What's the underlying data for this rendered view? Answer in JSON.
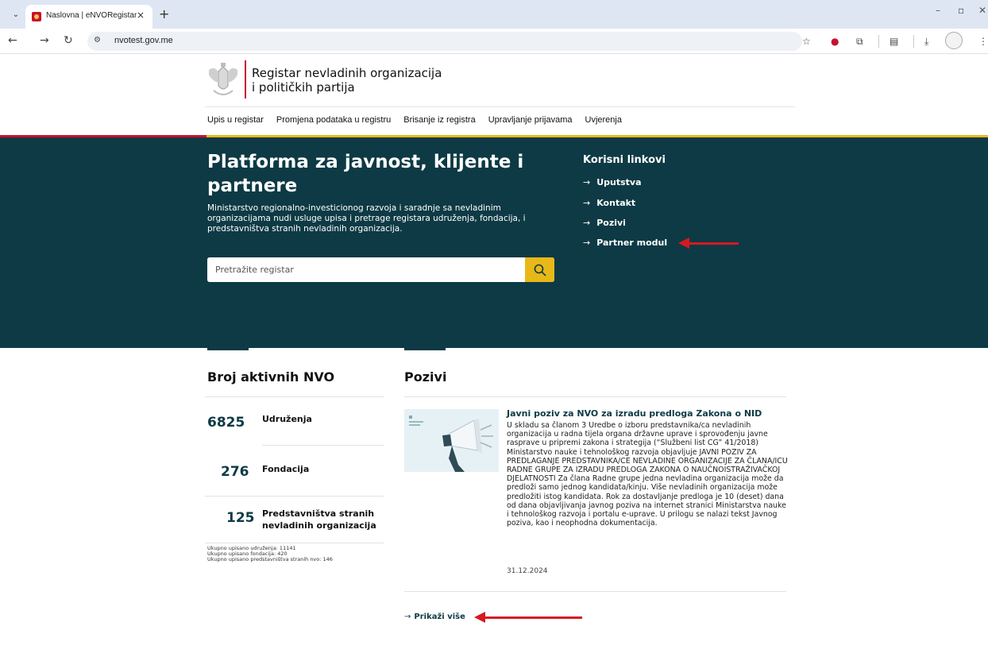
{
  "browser": {
    "tab_title": "Naslovna | eNVORegistar",
    "url": "nvotest.gov.me"
  },
  "site": {
    "logo_line1": "Registar nevladinih organizacija",
    "logo_line2": "i političkih partija",
    "nav": [
      "Upis u registar",
      "Promjena podataka u registru",
      "Brisanje iz registra",
      "Upravljanje prijavama",
      "Uvjerenja"
    ]
  },
  "hero": {
    "title": "Platforma za javnost, klijente i partnere",
    "intro": "Ministarstvo regionalno-investicionog razvoja i saradnje sa nevladinim organizacijama nudi usluge upisa i pretrage registara udruženja, fondacija, i predstavništva stranih nevladinih organizacija.",
    "search_placeholder": "Pretražite registar",
    "links_title": "Korisni linkovi",
    "links": [
      "Uputstva",
      "Kontakt",
      "Pozivi",
      "Partner modul"
    ]
  },
  "stats": {
    "title": "Broj aktivnih NVO",
    "items": [
      {
        "num": "6825",
        "label": "Udruženja"
      },
      {
        "num": "276",
        "label": "Fondacija"
      },
      {
        "num": "125",
        "label": "Predstavništva stranih nevladinih organizacija"
      }
    ],
    "totals": [
      "Ukupno upisano udruženja: 11141",
      "Ukupno upisano fondacija: 420",
      "Ukupno upisano predstavništva stranih nvo: 146"
    ]
  },
  "calls": {
    "title": "Pozivi",
    "item_title": "Javni poziv za NVO za izradu predloga Zakona o NID",
    "item_body": "U skladu sa članom 3 Uredbe o izboru predstavnika/ca nevladinih organizacija u radna tijela organa državne uprave i sprovođenju javne rasprave u pripremi zakona i strategija (“Službeni list CG” 41/2018) Ministarstvo nauke i tehnološkog razvoja objavljuje JAVNI POZIV ZA PREDLAGANJE PREDSTAVNIKA/CE NEVLADINE ORGANIZACIJE ZA ČLANA/ICU RADNE GRUPE ZA IZRADU PREDLOGA ZAKONA O NAUČNOISTRAŽIVAČKOJ DJELATNOSTI Za člana Radne grupe jedna nevladina organizacija može da predloži samo jednog kandidata/kinju. Više nevladinih organizacija može predložiti istog kandidata. Rok za dostavljanje predloga je 10 (deset) dana od dana objavljivanja javnog poziva na internet stranici Ministarstva nauke i tehnološkog razvoja i portalu e-uprave. U prilogu se nalazi tekst Javnog poziva, kao i neophodna dokumentacija.",
    "item_date": "31.12.2024",
    "more": "Prikaži više"
  },
  "colors": {
    "primary": "#0d3a45",
    "accent": "#e8b818",
    "brand_red": "#c8102e",
    "annotation_arrow": "#d71920"
  }
}
